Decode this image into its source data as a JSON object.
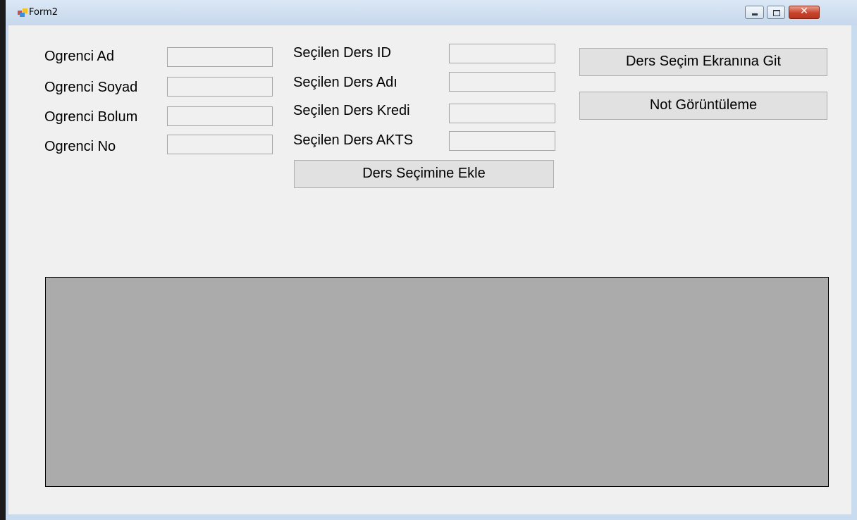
{
  "window": {
    "title": "Form2",
    "icon": "windows-form-icon",
    "controls": {
      "minimize": "minimize-icon",
      "maximize": "maximize-icon",
      "close_label": "✕"
    }
  },
  "student": {
    "ad_label": "Ogrenci Ad",
    "soyad_label": "Ogrenci Soyad",
    "bolum_label": "Ogrenci Bolum",
    "no_label": "Ogrenci No"
  },
  "selected_course": {
    "id_label": "Seçilen Ders ID",
    "adi_label": "Seçilen Ders Adı",
    "kredi_label": "Seçilen Ders Kredi",
    "akts_label": "Seçilen Ders AKTS",
    "add_button": "Ders Seçimine Ekle"
  },
  "actions": {
    "go_selection": "Ders Seçim Ekranına Git",
    "grades": "Not Görüntüleme"
  },
  "colors": {
    "client_bg": "#f0f0f0",
    "grid_bg": "#ababab",
    "button_bg": "#e1e1e1"
  }
}
